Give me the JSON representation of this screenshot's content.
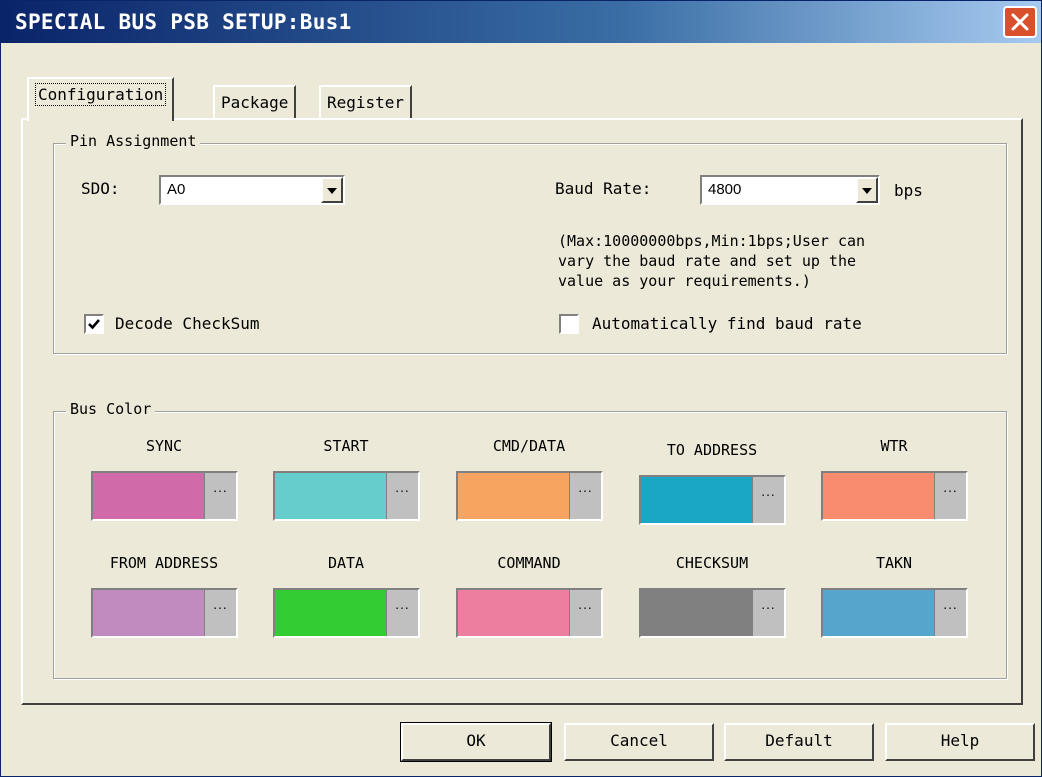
{
  "window": {
    "title": "SPECIAL BUS PSB SETUP:Bus1"
  },
  "tabs": [
    {
      "label": "Configuration"
    },
    {
      "label": "Package"
    },
    {
      "label": "Register"
    }
  ],
  "pin_assignment": {
    "group_label": "Pin Assignment",
    "sdo_label": "SDO:",
    "sdo_value": "A0",
    "baud_label": "Baud Rate:",
    "baud_value": "4800",
    "baud_unit": "bps",
    "baud_note": "(Max:10000000bps,Min:1bps;User can\nvary the baud rate and set up the\nvalue as your requirements.)",
    "decode_checksum_label": "Decode CheckSum",
    "decode_checksum_checked": true,
    "auto_baud_label": "Automatically find baud rate",
    "auto_baud_checked": false
  },
  "bus_color": {
    "group_label": "Bus Color",
    "more_label": "...",
    "items": [
      {
        "name": "SYNC",
        "color": "#d16aa9"
      },
      {
        "name": "START",
        "color": "#66cccc"
      },
      {
        "name": "CMD/DATA",
        "color": "#f7a461"
      },
      {
        "name": "TO ADDRESS",
        "color": "#1aa6c5"
      },
      {
        "name": "WTR",
        "color": "#f98b6e"
      },
      {
        "name": "FROM ADDRESS",
        "color": "#c28bbf"
      },
      {
        "name": "DATA",
        "color": "#33cc33"
      },
      {
        "name": "COMMAND",
        "color": "#ed7e9f"
      },
      {
        "name": "CHECKSUM",
        "color": "#808080"
      },
      {
        "name": "TAKN",
        "color": "#56a5cc"
      }
    ]
  },
  "buttons": {
    "ok": "OK",
    "cancel": "Cancel",
    "default": "Default",
    "help": "Help"
  }
}
